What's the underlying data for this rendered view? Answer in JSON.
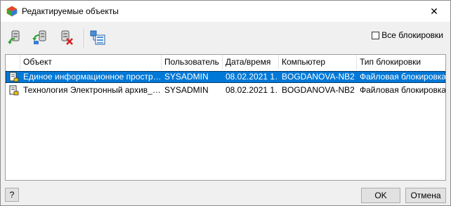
{
  "window": {
    "title": "Редактируемые объекты",
    "close_glyph": "✕"
  },
  "toolbar": {
    "buttons": [
      {
        "icon": "unlock-green-arrow-icon"
      },
      {
        "icon": "unlock-all-icon"
      },
      {
        "icon": "delete-lock-icon"
      },
      {
        "icon": "structure-tree-icon"
      }
    ],
    "all_locks_label": "Все блокировки",
    "all_locks_checked": false
  },
  "table": {
    "columns": [
      "Объект",
      "Пользователь",
      "Дата/время",
      "Компьютер",
      "Тип блокировки"
    ],
    "rows": [
      {
        "object": "Единое информационное простр…",
        "user": "SYSADMIN",
        "datetime": "08.02.2021 1…",
        "computer": "BOGDANOVA-NB2",
        "lock_type": "Файловая блокировка",
        "selected": true
      },
      {
        "object": "Технология Электронный архив_…",
        "user": "SYSADMIN",
        "datetime": "08.02.2021 1…",
        "computer": "BOGDANOVA-NB2",
        "lock_type": "Файловая блокировка",
        "selected": false
      }
    ]
  },
  "footer": {
    "help_label": "?",
    "ok_label": "OK",
    "cancel_label": "Отмена"
  },
  "colors": {
    "selection": "#0078d7",
    "accent_green": "#3aa63a",
    "delete_red": "#d42020"
  }
}
